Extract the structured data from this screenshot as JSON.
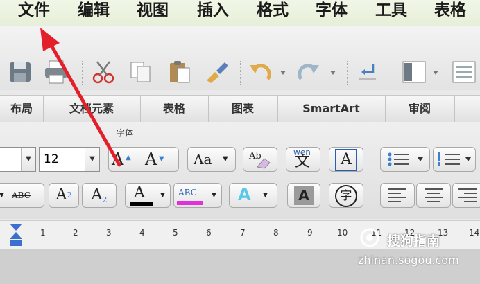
{
  "menubar": {
    "items": [
      "文件",
      "编辑",
      "视图",
      "插入",
      "格式",
      "字体",
      "工具",
      "表格"
    ]
  },
  "tabs": [
    "布局",
    "文档元素",
    "表格",
    "图表",
    "SmartArt",
    "审阅"
  ],
  "ribbon": {
    "group_label": "字体",
    "font_size": "12",
    "grow_font": "A",
    "shrink_font": "A",
    "change_case": "Aa",
    "phonetic": "wen",
    "phonetic_char": "文",
    "char_border": "A",
    "strikethrough": "ABC",
    "superscript_base": "A",
    "superscript_mark": "2",
    "subscript_base": "A",
    "subscript_mark": "2",
    "font_color": "A",
    "highlight": "ABC",
    "text_effects": "A",
    "char_shading": "A",
    "enclose_char": "字"
  },
  "ruler": {
    "numbers": [
      "1",
      "2",
      "3",
      "4",
      "5",
      "6",
      "7",
      "8",
      "9",
      "10",
      "11",
      "12",
      "13",
      "14"
    ]
  },
  "watermark": {
    "brand": "搜狗指南",
    "url": "zhinan.sogou.com"
  },
  "colors": {
    "menubar": "#e6efd9",
    "arrow": "#e3202a",
    "font_color_bar": "#000000",
    "highlight_bar": "#e030d8",
    "text_effects": "#5ac8e8"
  }
}
